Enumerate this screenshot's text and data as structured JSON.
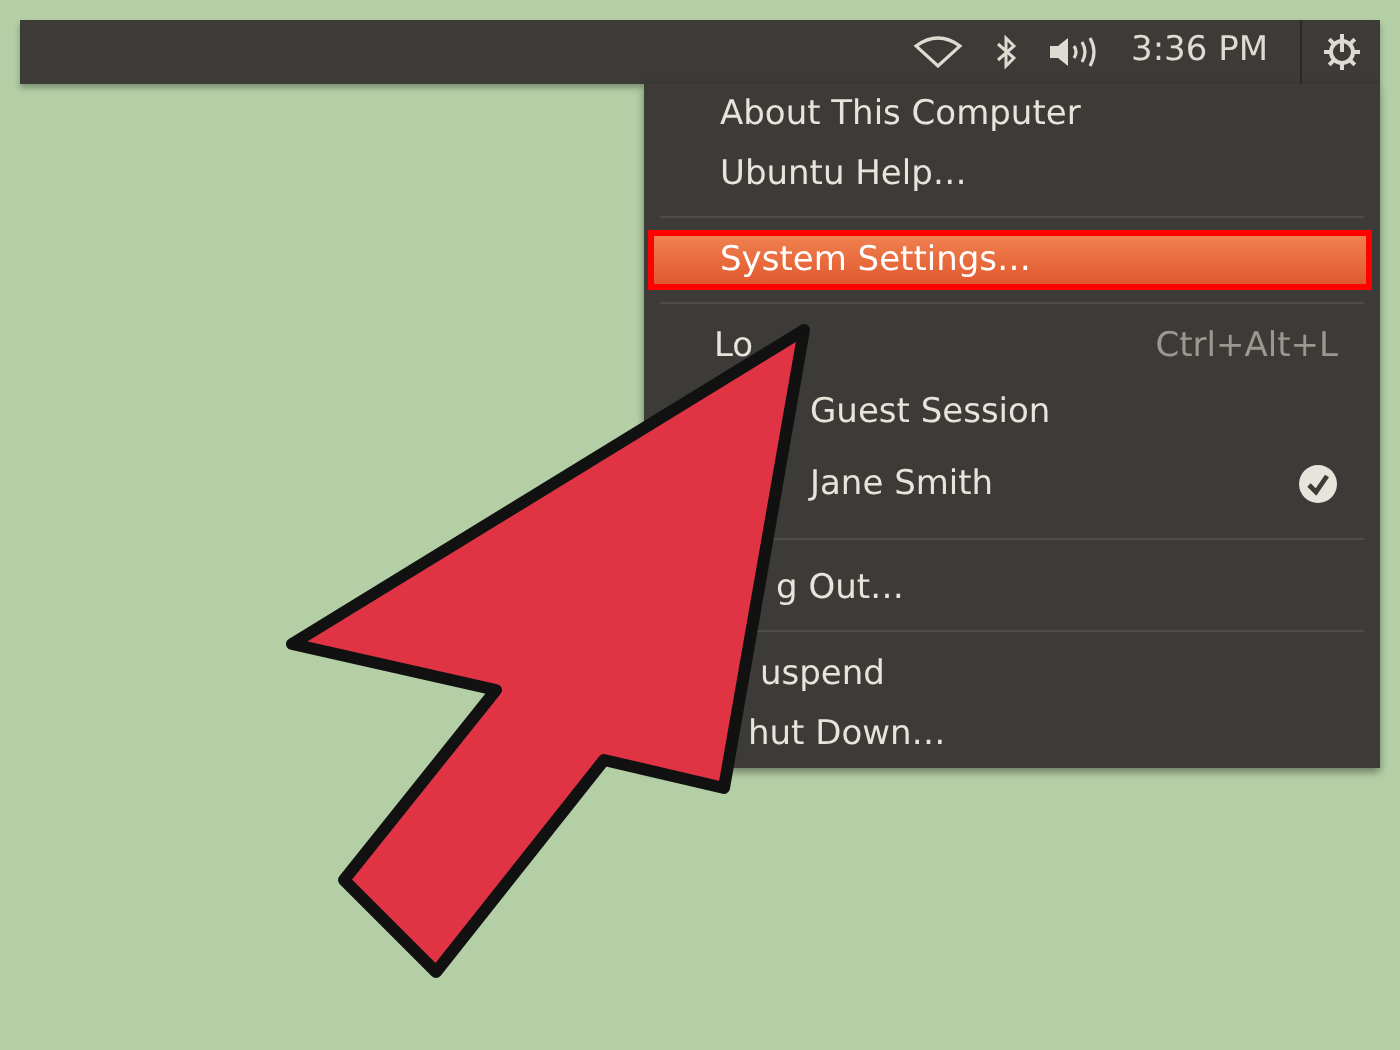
{
  "top_bar": {
    "clock": "3:36 PM"
  },
  "menu": {
    "items": [
      {
        "kind": "item",
        "label": "About This Computer",
        "selected": false,
        "outlined": false
      },
      {
        "kind": "item",
        "label": "Ubuntu Help…",
        "selected": false,
        "outlined": false
      },
      {
        "kind": "separator"
      },
      {
        "kind": "item",
        "label": "System Settings…",
        "selected": true,
        "outlined": true
      },
      {
        "kind": "separator"
      },
      {
        "kind": "item",
        "label": "Lo",
        "shortcut": "Ctrl+Alt+L",
        "selected": false,
        "outlined": false
      },
      {
        "kind": "user",
        "label": "Guest Session",
        "checked": false
      },
      {
        "kind": "user",
        "label": "Jane Smith",
        "checked": true
      },
      {
        "kind": "separator"
      },
      {
        "kind": "item",
        "label": "g Out…",
        "selected": false,
        "outlined": false
      },
      {
        "kind": "separator"
      },
      {
        "kind": "item",
        "label": "uspend",
        "selected": false,
        "outlined": false
      },
      {
        "kind": "item",
        "label": "hut Down…",
        "selected": false,
        "outlined": false
      }
    ]
  }
}
